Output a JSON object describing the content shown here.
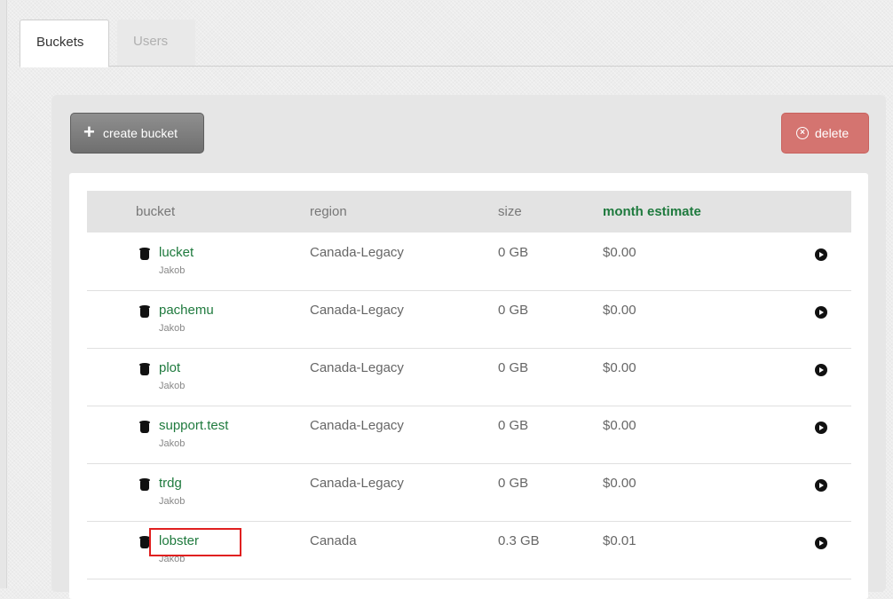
{
  "tabs": [
    {
      "label": "Buckets",
      "active": true
    },
    {
      "label": "Users",
      "active": false
    }
  ],
  "toolbar": {
    "create_label": "create bucket",
    "delete_label": "delete"
  },
  "table": {
    "headers": [
      "bucket",
      "region",
      "size",
      "month estimate"
    ],
    "rows": [
      {
        "name": "lucket",
        "owner": "Jakob",
        "region": "Canada-Legacy",
        "size": "0 GB",
        "estimate": "$0.00"
      },
      {
        "name": "pachemu",
        "owner": "Jakob",
        "region": "Canada-Legacy",
        "size": "0 GB",
        "estimate": "$0.00"
      },
      {
        "name": "plot",
        "owner": "Jakob",
        "region": "Canada-Legacy",
        "size": "0 GB",
        "estimate": "$0.00"
      },
      {
        "name": "support.test",
        "owner": "Jakob",
        "region": "Canada-Legacy",
        "size": "0 GB",
        "estimate": "$0.00"
      },
      {
        "name": "trdg",
        "owner": "Jakob",
        "region": "Canada-Legacy",
        "size": "0 GB",
        "estimate": "$0.00"
      },
      {
        "name": "lobster",
        "owner": "Jakob",
        "region": "Canada",
        "size": "0.3 GB",
        "estimate": "$0.01"
      }
    ]
  },
  "icons": {
    "create": "plus-icon",
    "delete": "close-circle-icon",
    "bucket": "bucket-icon",
    "row_action": "arrow-right-circle-icon"
  },
  "colors": {
    "accent": "#1f7a3e",
    "delete": "#d47470",
    "create": "#7a7a7a",
    "highlight": "#e02020"
  }
}
